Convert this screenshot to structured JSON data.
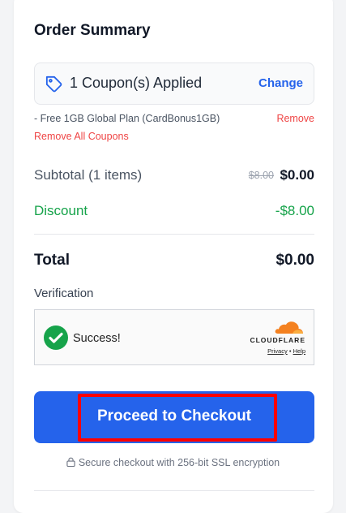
{
  "summary": {
    "title": "Order Summary"
  },
  "coupon": {
    "status": "1 Coupon(s) Applied",
    "change_label": "Change",
    "items": [
      {
        "text": "- Free 1GB Global Plan (CardBonus1GB)",
        "remove_label": "Remove"
      }
    ],
    "remove_all_label": "Remove All Coupons"
  },
  "subtotal": {
    "label": "Subtotal (1 items)",
    "original_price": "$8.00",
    "value": "$0.00"
  },
  "discount": {
    "label": "Discount",
    "value": "-$8.00"
  },
  "total": {
    "label": "Total",
    "value": "$0.00"
  },
  "verification": {
    "label": "Verification",
    "status": "Success!",
    "brand": "CLOUDFLARE",
    "privacy_label": "Privacy",
    "separator": "•",
    "help_label": "Help"
  },
  "checkout": {
    "button_label": "Proceed to Checkout"
  },
  "secure_note": "Secure checkout with 256-bit SSL encryption",
  "colors": {
    "accent": "#2563eb",
    "danger": "#ef4444",
    "success": "#16a34a",
    "highlight": "#ff0000",
    "cloudflare": "#f48120"
  },
  "icons": [
    "tag-icon",
    "check-circle-icon",
    "cloudflare-logo-icon",
    "lock-icon"
  ]
}
